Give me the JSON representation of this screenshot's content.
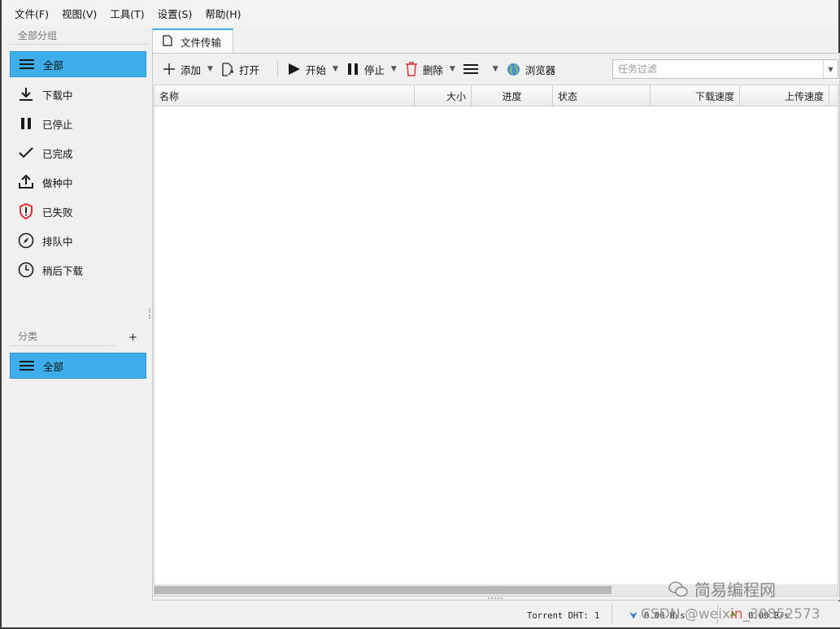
{
  "menu": [
    "文件(F)",
    "视图(V)",
    "工具(T)",
    "设置(S)",
    "帮助(H)"
  ],
  "sidebar": {
    "groups_title": "全部分组",
    "groups": [
      {
        "label": "全部",
        "icon": "list-icon",
        "active": true
      },
      {
        "label": "下载中",
        "icon": "download-icon",
        "active": false
      },
      {
        "label": "已停止",
        "icon": "pause-icon",
        "active": false
      },
      {
        "label": "已完成",
        "icon": "check-icon",
        "active": false
      },
      {
        "label": "做种中",
        "icon": "upload-icon",
        "active": false
      },
      {
        "label": "已失败",
        "icon": "shield-alert-icon",
        "active": false
      },
      {
        "label": "排队中",
        "icon": "compass-icon",
        "active": false
      },
      {
        "label": "稍后下载",
        "icon": "clock-icon",
        "active": false
      }
    ],
    "categories_title": "分类",
    "add_category": "+",
    "categories": [
      {
        "label": "全部",
        "icon": "list-icon",
        "active": true
      }
    ]
  },
  "tab": {
    "label": "文件传输"
  },
  "toolbar": {
    "add": "添加",
    "open": "打开",
    "start": "开始",
    "stop": "停止",
    "delete": "删除",
    "browser": "浏览器",
    "filter_placeholder": "任务过滤"
  },
  "columns": [
    "名称",
    "大小",
    "进度",
    "状态",
    "下载速度",
    "上传速度"
  ],
  "status": {
    "dht_label": "Torrent DHT:",
    "dht_count": "1",
    "download_speed": "0.00 B/s",
    "upload_speed": "0.00 B/s"
  },
  "watermark": {
    "text": "简易编程网",
    "csdn_prefix": "CSDN @weix",
    "csdn_mid": "in",
    "csdn_suffix": "_30852573"
  }
}
